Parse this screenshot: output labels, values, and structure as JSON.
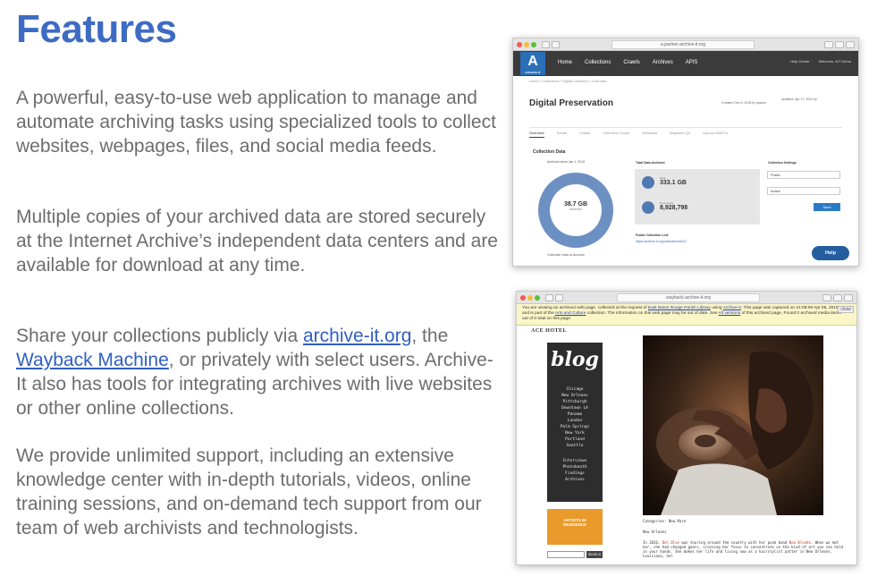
{
  "page": {
    "title": "Features",
    "paragraphs": [
      {
        "text": "A powerful, easy-to-use web application to manage and automate archiving tasks using specialized tools to collect websites, webpages, files, and social media feeds."
      },
      {
        "text": "Multiple copies of your archived data are stored securely at the Internet Archive’s independent data centers and are available for download at any time."
      },
      {
        "pre": "Share your collections publicly via ",
        "link1": "archive-it.org",
        "mid": ", the ",
        "link2": "Wayback Machine",
        "post": ", or privately with select users. Archive-It also has tools for integrating archives with live websites or other online collections."
      },
      {
        "text": "We provide unlimited support, including an extensive knowledge center with in-depth tutorials, videos, online training sessions, and on-demand tech support from our team of web archivists and technologists."
      }
    ],
    "accent_color": "#3d6bc4",
    "link_color": "#2f5fc4"
  },
  "screenshot1": {
    "url": "a.partner.archive-it.org",
    "logo_letter": "A",
    "logo_text": "ARCHIVE-IT",
    "nav": [
      "Home",
      "Collections",
      "Crawls",
      "Archives",
      "APIS"
    ],
    "nav_right": [
      "Help Center",
      "Welcome, AIT Demo"
    ],
    "breadcrumb": "Home  /  Collections  /  Digital Collection  /  Overview",
    "title": "Digital Preservation",
    "created": "Created: Dec 6, 2018 by system",
    "updated": "Updated: Apr 17, 2020 by",
    "tabs": [
      "Overview",
      "Seeds",
      "Crawls",
      "Collection Scope",
      "Metadata",
      "Wayback QA",
      "Upload WARCs"
    ],
    "section": "Collection Data",
    "archived_since": "Archived since Jan 1, 2018",
    "donut_value": "38.7 GB",
    "donut_label": "archived",
    "donut_caption": "Collection Data vs Account",
    "total_label": "Total Data Archived",
    "stat1_label": "Data",
    "stat1_value": "333.1 GB",
    "stat2_label": "Documents",
    "stat2_value": "8,928,798",
    "settings_label": "Collection Settings",
    "select1": "Public",
    "select2": "Active",
    "save": "Save",
    "public_links_label": "Public Collection Link",
    "public_link": "https://archive-it.org/collections/6412",
    "help": "Help",
    "donut_fraction": 1.0
  },
  "screenshot2": {
    "url": "wayback.archive-it.org",
    "banner_pre": "You are viewing an archived web page, collected at the request of ",
    "banner_link1": "East Baton Rouge Parish Library",
    "banner_mid1": " using ",
    "banner_link2": "Archive-It",
    "banner_mid2": ". This page was captured on 21:08:09 Apr 08, 2018, and is part of the ",
    "banner_link3": "Arts and Culture",
    "banner_mid3": " collection. The information on this web page may be out of date. See ",
    "banner_link4": "All versions",
    "banner_post": " of this archived page. Found 0 archived media items out of 0 total on this page.",
    "close": "close",
    "site_name": "ACE HOTEL",
    "blog": "blog",
    "cities": [
      "Chicago",
      "New Orleans",
      "Pittsburgh",
      "Downtown LA",
      "Panama",
      "London",
      "Palm Springs",
      "New York",
      "Portland",
      "Seattle"
    ],
    "more": [
      "Interviews",
      "Photobooth",
      "Findings",
      "Archives"
    ],
    "artists": "ARTISTS IN RESIDENCE",
    "go": "SEARCH",
    "caption": "Categories: New Mare",
    "caption2": "New Orleans",
    "body_pre": "In 2016, ",
    "body_red1": "Del Blue",
    "body_mid": " was touring around the country with her punk band ",
    "body_red2": "Neo Blonde",
    "body_post": ". When we met her, she had changed gears, crossing her focus to concentrate on the kind of art you can hold in your hands. She makes her life and living now as a hairstylist potter in New Orleans, Louisiana, hel"
  }
}
